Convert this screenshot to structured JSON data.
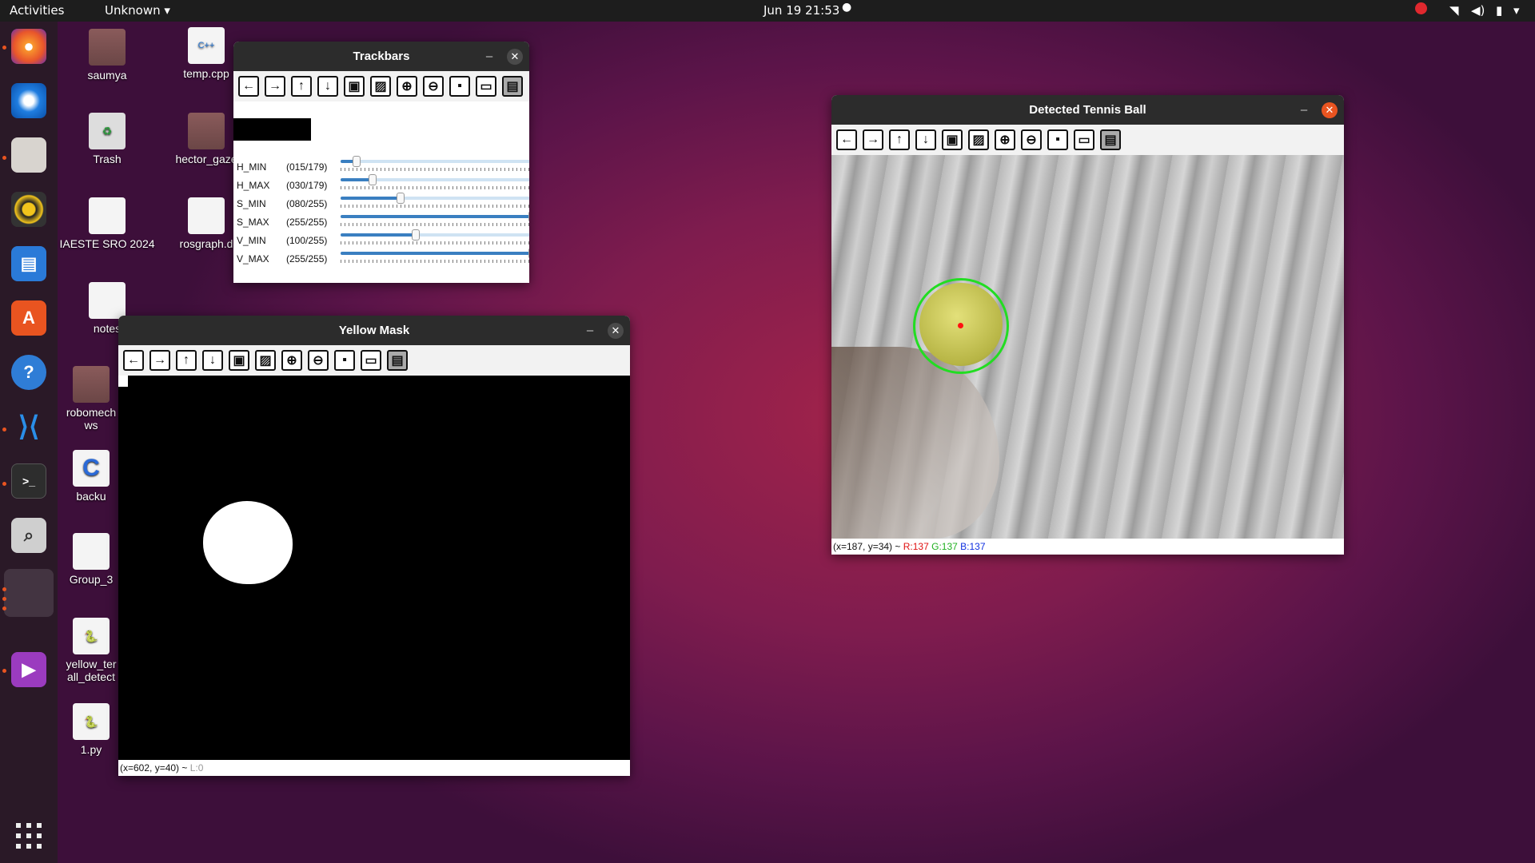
{
  "topbar": {
    "activities": "Activities",
    "app_menu": "Unknown",
    "datetime": "Jun 19  21:53"
  },
  "dock": {
    "apps": [
      "Firefox",
      "Thunderbird",
      "Files",
      "Rhythmbox",
      "LibreOffice Writer",
      "Ubuntu Software",
      "Help",
      "Visual Studio Code",
      "Terminal",
      "Magnifier",
      "Window",
      "Videos"
    ]
  },
  "desktop": {
    "icons": [
      "saumya",
      "temp.cpp",
      "Trash",
      "hector_gaze",
      "IAESTE SRO 2024",
      "rosgraph.d",
      "notes",
      "robomech ws",
      "backu",
      "Group_3",
      "yellow_ter all_detect",
      "1.py"
    ]
  },
  "trackbars": {
    "title": "Trackbars",
    "rows": [
      {
        "name": "H_MIN",
        "value": "(015/179)",
        "level": 0.084
      },
      {
        "name": "H_MAX",
        "value": "(030/179)",
        "level": 0.168
      },
      {
        "name": "S_MIN",
        "value": "(080/255)",
        "level": 0.314
      },
      {
        "name": "S_MAX",
        "value": "(255/255)",
        "level": 1.0
      },
      {
        "name": "V_MIN",
        "value": "(100/255)",
        "level": 0.392
      },
      {
        "name": "V_MAX",
        "value": "(255/255)",
        "level": 1.0
      }
    ]
  },
  "mask": {
    "title": "Yellow Mask",
    "status": "(x=602, y=40) ~ ",
    "status_l": "L:0"
  },
  "detected": {
    "title": "Detected Tennis Ball",
    "status_pos": "(x=187, y=34) ~ ",
    "r": "R:137",
    "g": "G:137",
    "b": "B:137"
  },
  "colors": {
    "accent": "#e95420",
    "circle": "#22dd22",
    "center": "#ff1111"
  }
}
